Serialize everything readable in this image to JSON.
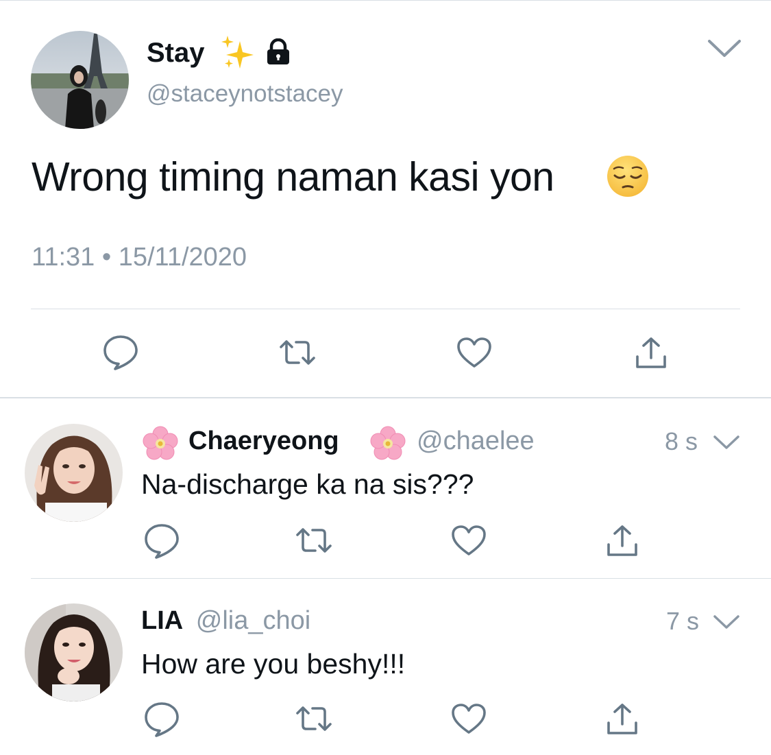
{
  "main_tweet": {
    "display_name": "Stay",
    "handle": "@staceynotstacey",
    "text": "Wrong timing naman kasi yon",
    "timestamp": "11:31 • 15/11/2020",
    "icons": [
      "sparkles-emoji",
      "lock-icon",
      "chevron-down-icon",
      "pensive-face-emoji"
    ],
    "actions": [
      "reply-icon",
      "retweet-icon",
      "like-icon",
      "share-icon"
    ]
  },
  "replies": [
    {
      "display_name": "Chaeryeong",
      "handle": "@chaelee",
      "time": "8 s",
      "text": "Na-discharge ka na sis???",
      "icons": [
        "cherry-blossom-emoji",
        "cherry-blossom-emoji"
      ]
    },
    {
      "display_name": "LIA",
      "handle": "@lia_choi",
      "time": "7 s",
      "text": "How are you beshy!!!",
      "icons": []
    }
  ],
  "colors": {
    "text": "#0f1419",
    "muted": "#8b98a5",
    "icon": "#657786",
    "divider": "#d9dfe4"
  }
}
